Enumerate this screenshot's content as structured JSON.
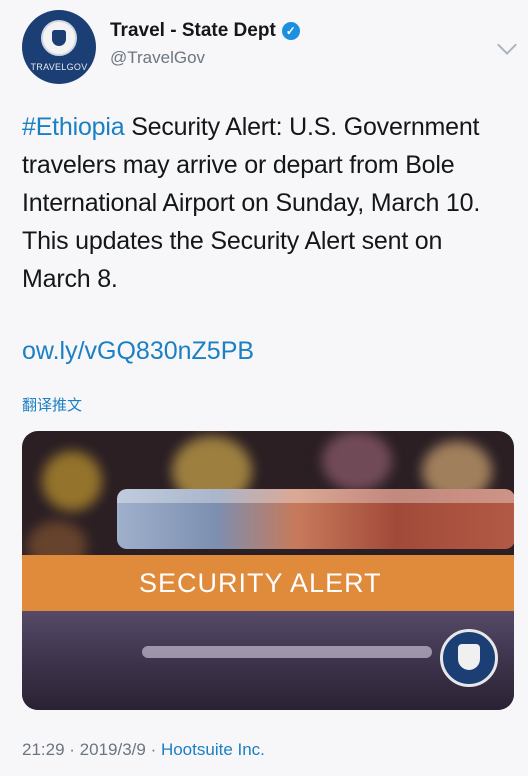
{
  "account": {
    "display_name": "Travel - State Dept",
    "handle": "@TravelGov",
    "avatar_label": "TRAVELGOV"
  },
  "tweet": {
    "hashtag": "#Ethiopia",
    "body": " Security Alert: U.S. Government travelers may arrive or depart from Bole International Airport on Sunday, March 10. This updates the Security Alert sent on March 8.",
    "link": "ow.ly/vGQ830nZ5PB",
    "translate_label": "翻译推文"
  },
  "card": {
    "banner_text": "SECURITY ALERT"
  },
  "meta": {
    "time": "21:29",
    "sep1": " · ",
    "date": "2019/3/9",
    "sep2": " · ",
    "source": "Hootsuite Inc."
  },
  "colors": {
    "link": "#1b7fc4",
    "banner": "#e08a3c",
    "verified": "#1d8fe1"
  },
  "icons": {
    "verified": "verified-badge-icon",
    "chevron": "chevron-down-icon"
  }
}
